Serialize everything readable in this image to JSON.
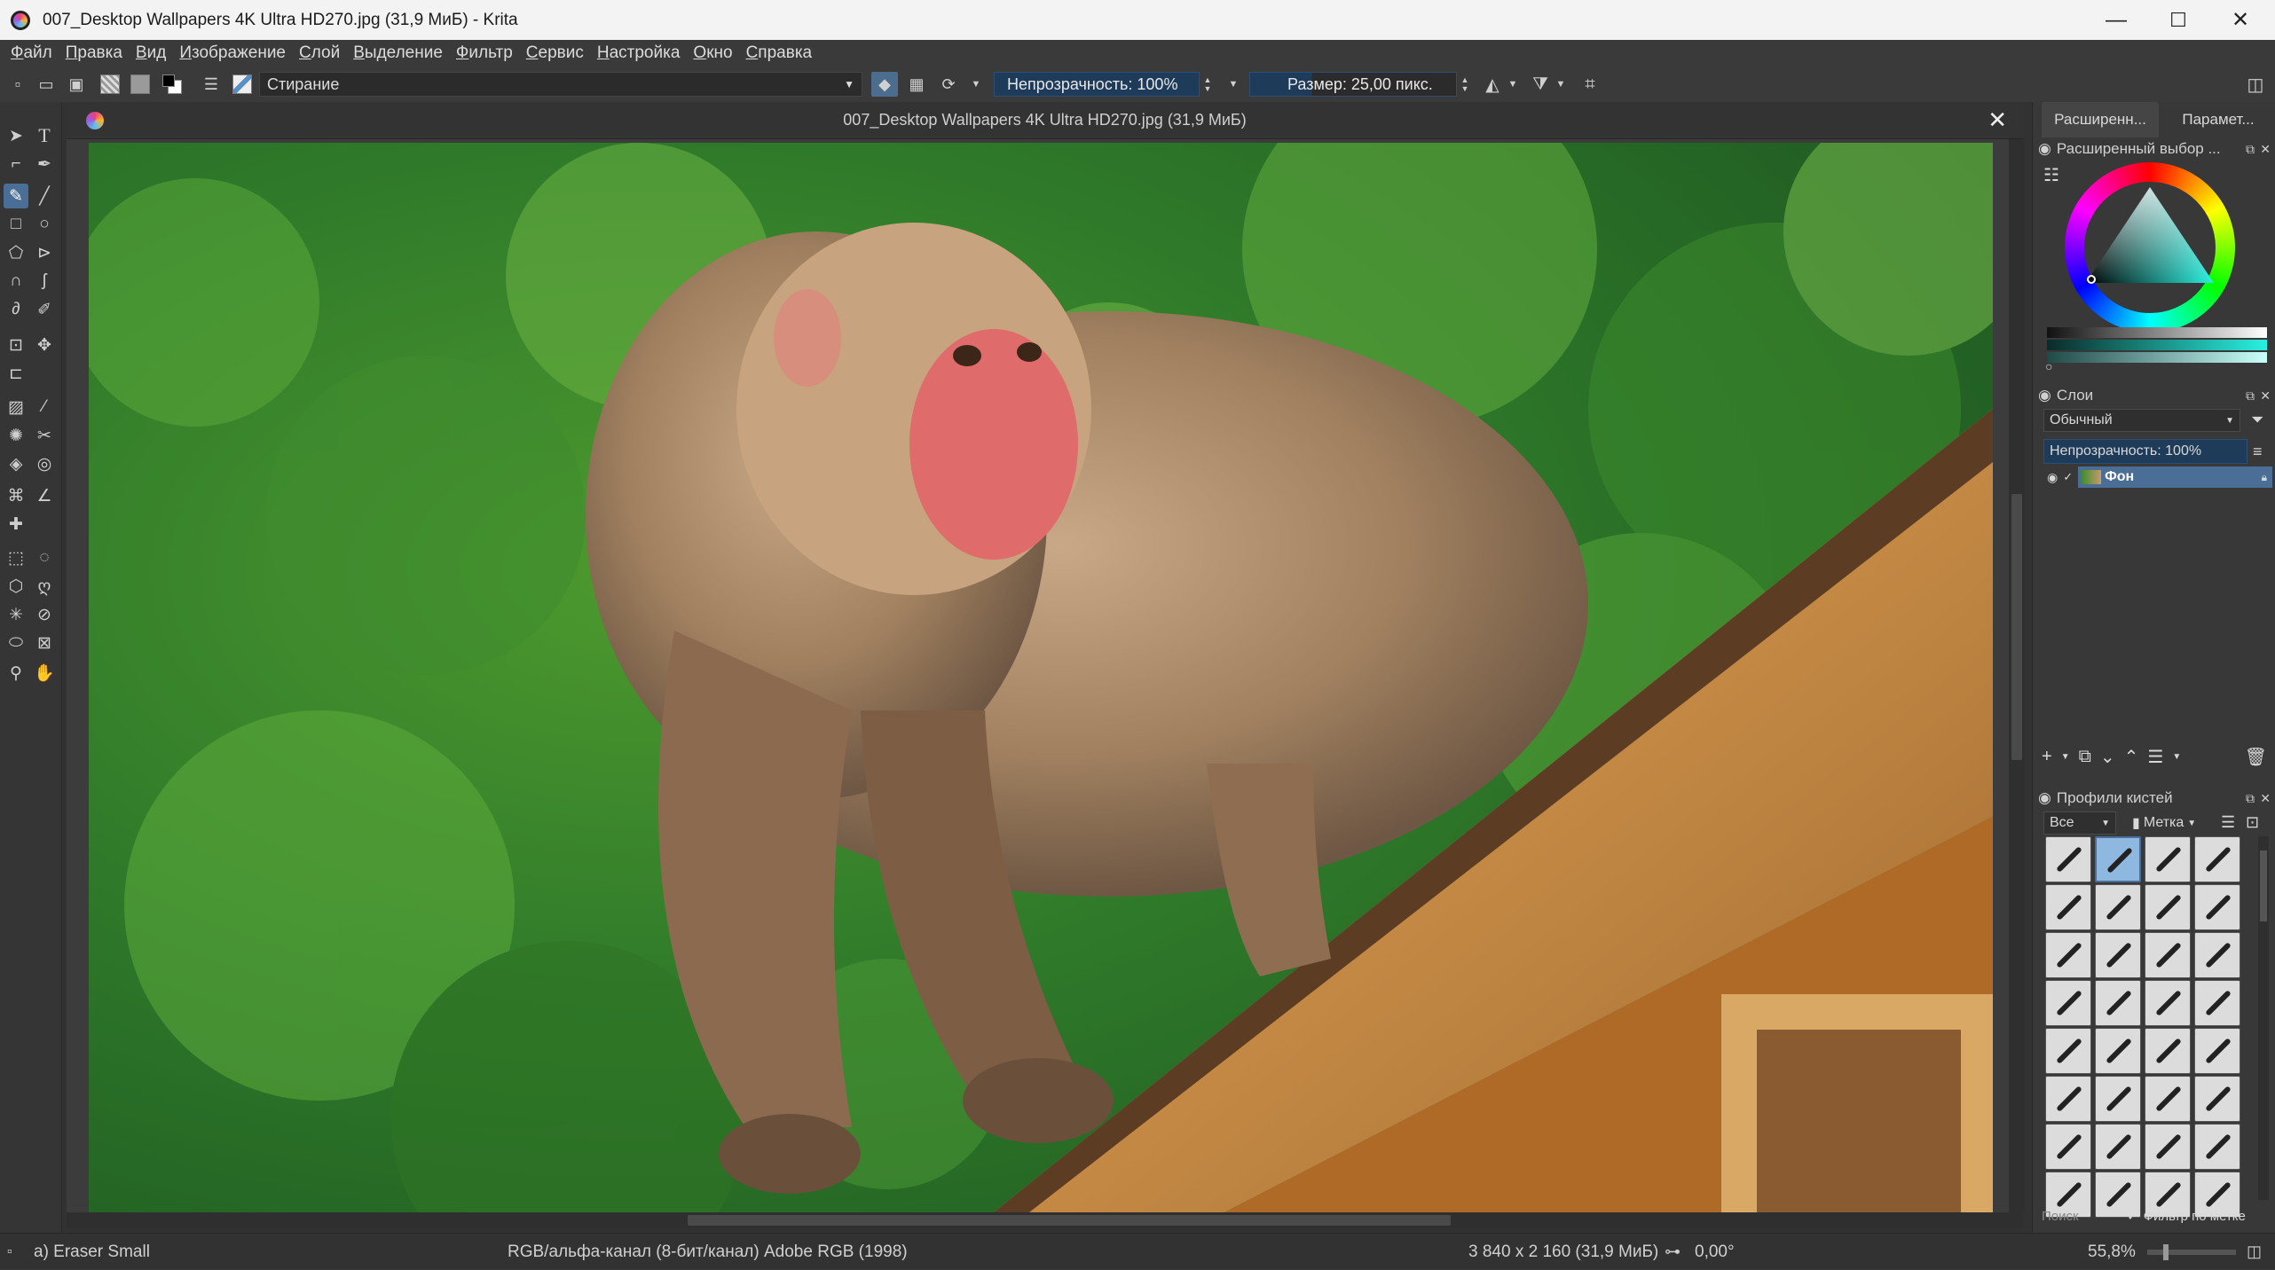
{
  "window": {
    "title": "007_Desktop Wallpapers 4K Ultra HD270.jpg (31,9 МиБ)  - Krita",
    "minimize_icon": "—",
    "maximize_icon": "☐",
    "close_icon": "✕"
  },
  "menu": [
    "Файл",
    "Правка",
    "Вид",
    "Изображение",
    "Слой",
    "Выделение",
    "Фильтр",
    "Сервис",
    "Настройка",
    "Окно",
    "Справка"
  ],
  "toolbar": {
    "preset_name": "Стирание",
    "opacity_label": "Непрозрачность: 100%",
    "size_label": "Размер: 25,00 пикс."
  },
  "document": {
    "tab_title": "007_Desktop Wallpapers 4K Ultra HD270.jpg (31,9 МиБ)",
    "close_icon": "✕"
  },
  "dockers": {
    "tabs": [
      "Расширенн...",
      "Парамет..."
    ],
    "color_selector_title": "Расширенный выбор ...",
    "layers_title": "Слои",
    "blend_mode": "Обычный",
    "layers_opacity": "Непрозрачность:  100%",
    "layer_name": "Фон",
    "brush_presets_title": "Профили кистей",
    "brush_filter": "Все",
    "brush_tag": "Метка",
    "search_placeholder": "Поиск",
    "filter_by_tag": "Фильтр по метке"
  },
  "status": {
    "brush": "a) Eraser Small",
    "color_space": "RGB/альфа-канал (8-бит/канал)  Adobe RGB (1998)",
    "dimensions": "3 840 x 2 160 (31,9 МиБ)",
    "rotation": "0,00°",
    "zoom": "55,8%"
  },
  "colors": {
    "accent": "#4a6e95",
    "field_bg": "#1f3b5a",
    "panel_bg": "#383838",
    "title_bg": "#f3f3f3"
  }
}
